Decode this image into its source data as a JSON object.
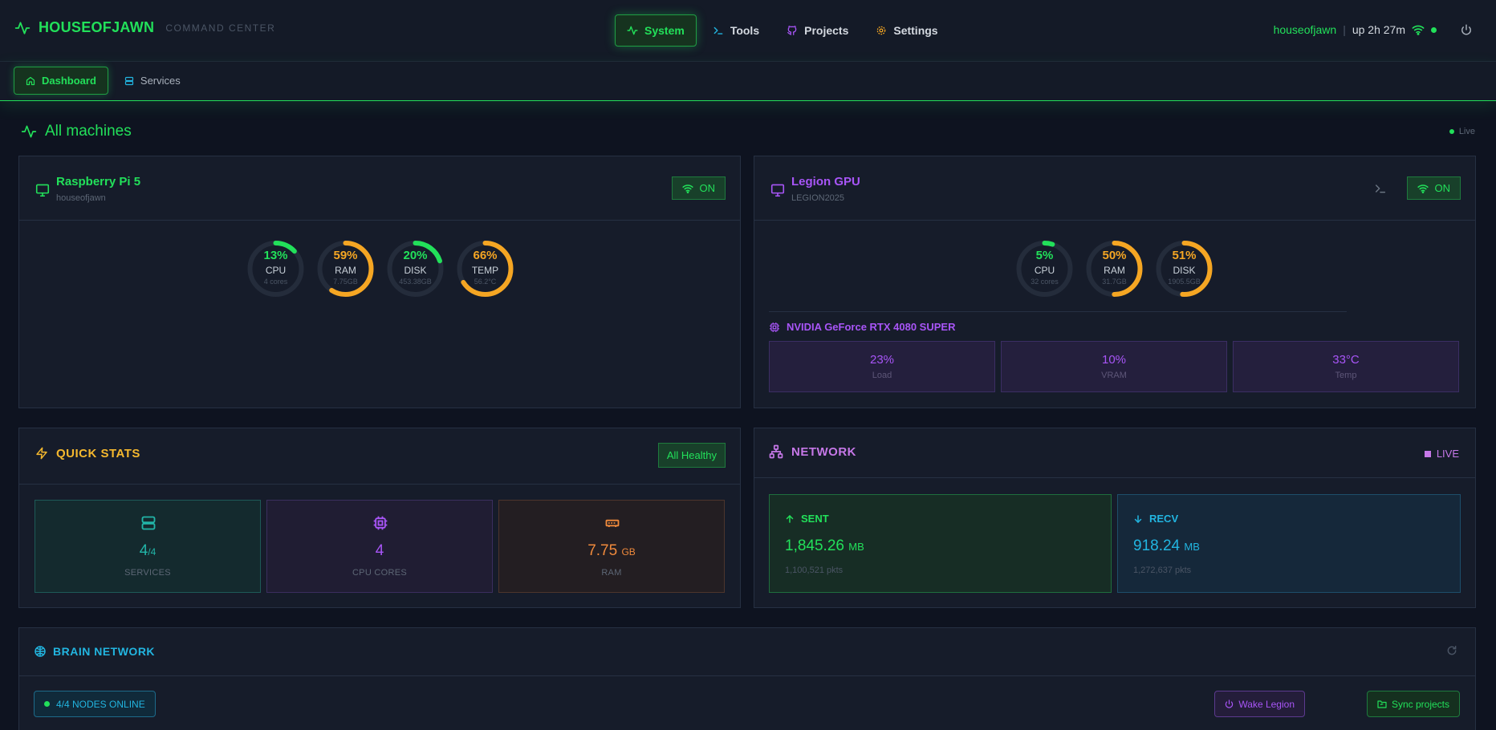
{
  "header": {
    "brand": "HOUSEOFJAWN",
    "subtitle": "COMMAND CENTER",
    "nav": [
      {
        "label": "System",
        "icon": "activity-icon",
        "active": true
      },
      {
        "label": "Tools",
        "icon": "terminal-icon",
        "active": false
      },
      {
        "label": "Projects",
        "icon": "github-icon",
        "active": false
      },
      {
        "label": "Settings",
        "icon": "gear-icon",
        "active": false
      }
    ],
    "user": "houseofjawn",
    "separator": "|",
    "uptime": "up 2h 27m"
  },
  "subnav": [
    {
      "label": "Dashboard",
      "icon": "home-icon",
      "active": true
    },
    {
      "label": "Services",
      "icon": "server-icon",
      "active": false
    }
  ],
  "machines_section": {
    "title": "All machines",
    "live": "Live"
  },
  "machines": [
    {
      "name": "Raspberry Pi 5",
      "host": "houseofjawn",
      "status": "ON",
      "gauges": [
        {
          "value": "13%",
          "label": "CPU",
          "sub": "4 cores",
          "pct": 13,
          "color": "#22e05a"
        },
        {
          "value": "59%",
          "label": "RAM",
          "sub": "7.75GB",
          "pct": 59,
          "color": "#f5a623"
        },
        {
          "value": "20%",
          "label": "DISK",
          "sub": "453.38GB",
          "pct": 20,
          "color": "#22e05a"
        },
        {
          "value": "66%",
          "label": "TEMP",
          "sub": "56.2°C",
          "pct": 66,
          "color": "#f5a623"
        }
      ]
    },
    {
      "name": "Legion GPU",
      "host": "LEGION2025",
      "status": "ON",
      "gauges": [
        {
          "value": "5%",
          "label": "CPU",
          "sub": "32 cores",
          "pct": 5,
          "color": "#22e05a"
        },
        {
          "value": "50%",
          "label": "RAM",
          "sub": "31.7GB",
          "pct": 50,
          "color": "#f5a623"
        },
        {
          "value": "51%",
          "label": "DISK",
          "sub": "1905.5GB",
          "pct": 51,
          "color": "#f5a623"
        }
      ],
      "gpu": {
        "name": "NVIDIA GeForce RTX 4080 SUPER",
        "stats": [
          {
            "value": "23%",
            "label": "Load"
          },
          {
            "value": "10%",
            "label": "VRAM"
          },
          {
            "value": "33°C",
            "label": "Temp"
          }
        ]
      }
    }
  ],
  "quick_stats": {
    "title": "QUICK STATS",
    "badge": "All Healthy",
    "cells": [
      {
        "value": "4",
        "suffix": "/4",
        "label": "SERVICES",
        "icon": "server-icon",
        "color": "#22b5a8"
      },
      {
        "value": "4",
        "suffix": "",
        "label": "CPU CORES",
        "icon": "cpu-icon",
        "color": "#a855f7"
      },
      {
        "value": "7.75",
        "suffix": "GB",
        "label": "RAM",
        "icon": "memory-icon",
        "color": "#f08a3c"
      }
    ]
  },
  "network": {
    "title": "NETWORK",
    "live": "LIVE",
    "sent": {
      "label": "SENT",
      "value": "1,845.26",
      "unit": "MB",
      "pkts": "1,100,521 pkts"
    },
    "recv": {
      "label": "RECV",
      "value": "918.24",
      "unit": "MB",
      "pkts": "1,272,637 pkts"
    }
  },
  "brain": {
    "title": "BRAIN NETWORK",
    "nodes": "4/4 NODES ONLINE",
    "wake": "Wake Legion",
    "sync": "Sync projects"
  },
  "colors": {
    "green": "#22e05a",
    "orange": "#f5a623",
    "purple": "#a855f7",
    "cyan": "#22b5e0",
    "background": "#0e1320"
  }
}
